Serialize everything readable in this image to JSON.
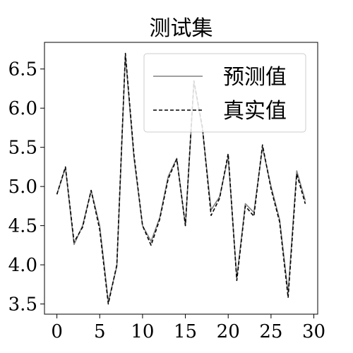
{
  "chart_data": {
    "type": "line",
    "title": "测试集",
    "xlabel": "",
    "ylabel": "",
    "xlim": [
      -1.45,
      30.45
    ],
    "ylim": [
      3.37,
      6.84
    ],
    "xticks": [
      0,
      5,
      10,
      15,
      20,
      25,
      30
    ],
    "xtick_labels": [
      "0",
      "5",
      "10",
      "15",
      "20",
      "25",
      "30"
    ],
    "yticks": [
      3.5,
      4.0,
      4.5,
      5.0,
      5.5,
      6.0,
      6.5
    ],
    "ytick_labels": [
      "3.5",
      "4.0",
      "4.5",
      "5.0",
      "5.5",
      "6.0",
      "6.5"
    ],
    "grid": false,
    "legend_position": "top-right",
    "x": [
      0,
      1,
      2,
      3,
      4,
      5,
      6,
      7,
      8,
      9,
      10,
      11,
      12,
      13,
      14,
      15,
      16,
      17,
      18,
      19,
      20,
      21,
      22,
      23,
      24,
      25,
      26,
      27,
      28,
      29
    ],
    "series": [
      {
        "name": "预测值",
        "color": "#808080",
        "style": "solid",
        "values": [
          4.9,
          5.24,
          4.26,
          4.5,
          4.95,
          4.5,
          3.53,
          3.98,
          6.68,
          5.36,
          4.5,
          4.3,
          4.6,
          5.13,
          5.36,
          4.5,
          6.33,
          5.73,
          4.7,
          4.87,
          5.38,
          3.83,
          4.78,
          4.67,
          5.5,
          5.0,
          4.58,
          3.64,
          5.2,
          4.82
        ]
      },
      {
        "name": "真实值",
        "color": "#000000",
        "style": "dashed",
        "values": [
          4.9,
          5.25,
          4.29,
          4.48,
          4.95,
          4.45,
          3.5,
          4.0,
          6.7,
          5.4,
          4.5,
          4.25,
          4.58,
          5.1,
          5.35,
          4.5,
          6.35,
          5.75,
          4.63,
          4.85,
          5.42,
          3.8,
          4.75,
          4.62,
          5.53,
          4.97,
          4.55,
          3.58,
          5.16,
          4.78
        ]
      }
    ]
  }
}
